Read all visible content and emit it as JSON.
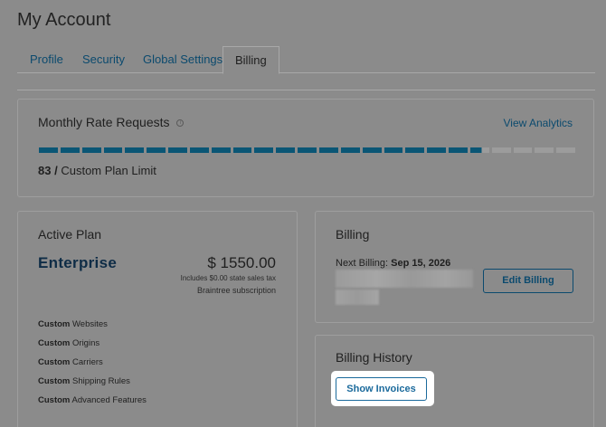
{
  "page": {
    "title": "My Account"
  },
  "tabs": [
    {
      "label": "Profile"
    },
    {
      "label": "Security"
    },
    {
      "label": "Global Settings"
    },
    {
      "label": "Billing",
      "active": true
    }
  ],
  "rate": {
    "heading": "Monthly Rate Requests",
    "info_icon": "info-icon",
    "view_analytics": "View Analytics",
    "usage_percent": 83,
    "count": "83",
    "separator": "/",
    "limit_label": "Custom Plan Limit"
  },
  "plan": {
    "heading": "Active Plan",
    "name": "Enterprise",
    "price": "$ 1550.00",
    "tax_note": "Includes $0.00 state sales tax",
    "provider": "Braintree subscription",
    "features": [
      {
        "bold": "Custom",
        "text": "Websites"
      },
      {
        "bold": "Custom",
        "text": "Origins"
      },
      {
        "bold": "Custom",
        "text": "Carriers"
      },
      {
        "bold": "Custom",
        "text": "Shipping Rules"
      },
      {
        "bold": "Custom",
        "text": "Advanced Features"
      }
    ]
  },
  "billing": {
    "heading": "Billing",
    "next_label": "Next Billing:",
    "next_date": "Sep 15, 2026",
    "edit_button": "Edit Billing"
  },
  "history": {
    "heading": "Billing History",
    "show_invoices": "Show Invoices"
  },
  "colors": {
    "accent": "#0b4a6e",
    "progress_fill": "#0a5675",
    "progress_empty": "#9c9c9c",
    "highlight": "#ffffff"
  }
}
